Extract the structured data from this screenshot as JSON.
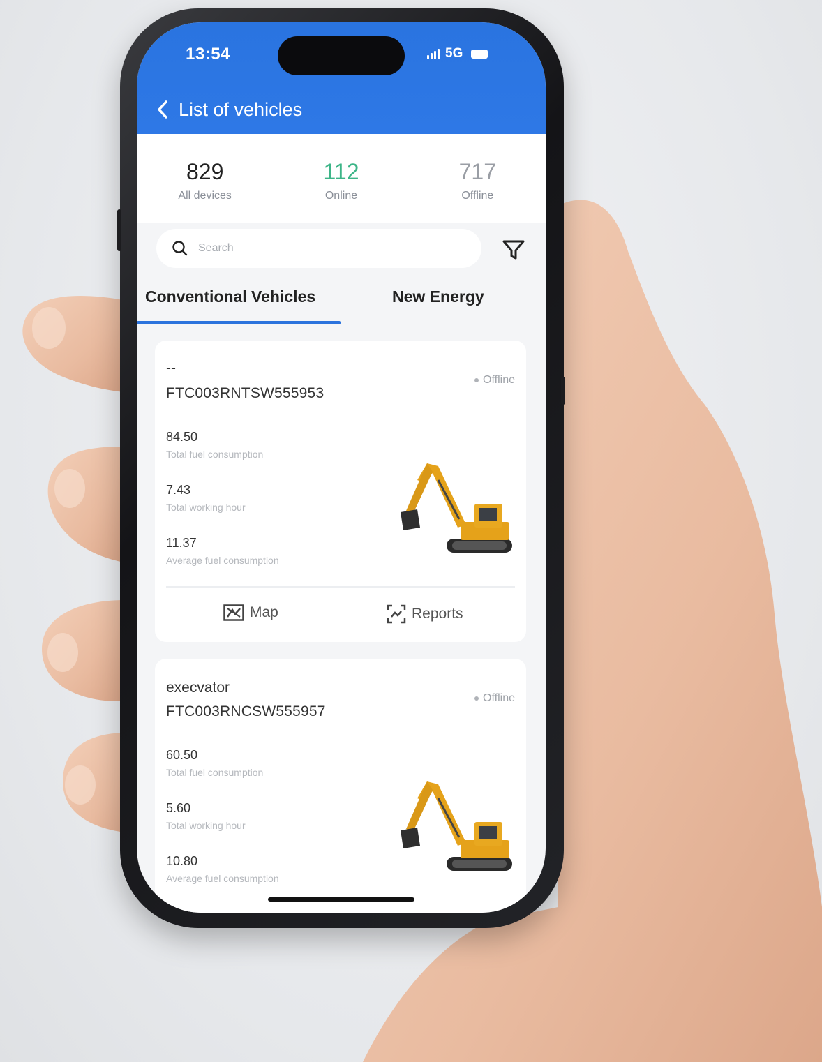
{
  "status_bar": {
    "time": "13:54",
    "network": "5G"
  },
  "header": {
    "title": "List of vehicles"
  },
  "stats": [
    {
      "value": "829",
      "label": "All devices"
    },
    {
      "value": "112",
      "label": "Online"
    },
    {
      "value": "717",
      "label": "Offline"
    }
  ],
  "search": {
    "placeholder": "Search"
  },
  "tabs": {
    "conventional": "Conventional Vehicles",
    "new_energy": "New Energy"
  },
  "vehicles": [
    {
      "name": "--",
      "id": "FTC003RNTSW555953",
      "status": "Offline",
      "metrics": [
        {
          "value": "84.50",
          "label": "Total fuel consumption"
        },
        {
          "value": "7.43",
          "label": "Total working hour"
        },
        {
          "value": "11.37",
          "label": "Average fuel consumption"
        }
      ],
      "actions": {
        "map": "Map",
        "reports": "Reports"
      }
    },
    {
      "name": "execvator",
      "id": "FTC003RNCSW555957",
      "status": "Offline",
      "metrics": [
        {
          "value": "60.50",
          "label": "Total fuel consumption"
        },
        {
          "value": "5.60",
          "label": "Total working hour"
        },
        {
          "value": "10.80",
          "label": "Average fuel consumption"
        }
      ]
    }
  ],
  "colors": {
    "header_blue": "#2e78e6",
    "online_green": "#3db588",
    "offline_gray": "#9a9ea5",
    "tab_underline": "#2b73dd"
  }
}
